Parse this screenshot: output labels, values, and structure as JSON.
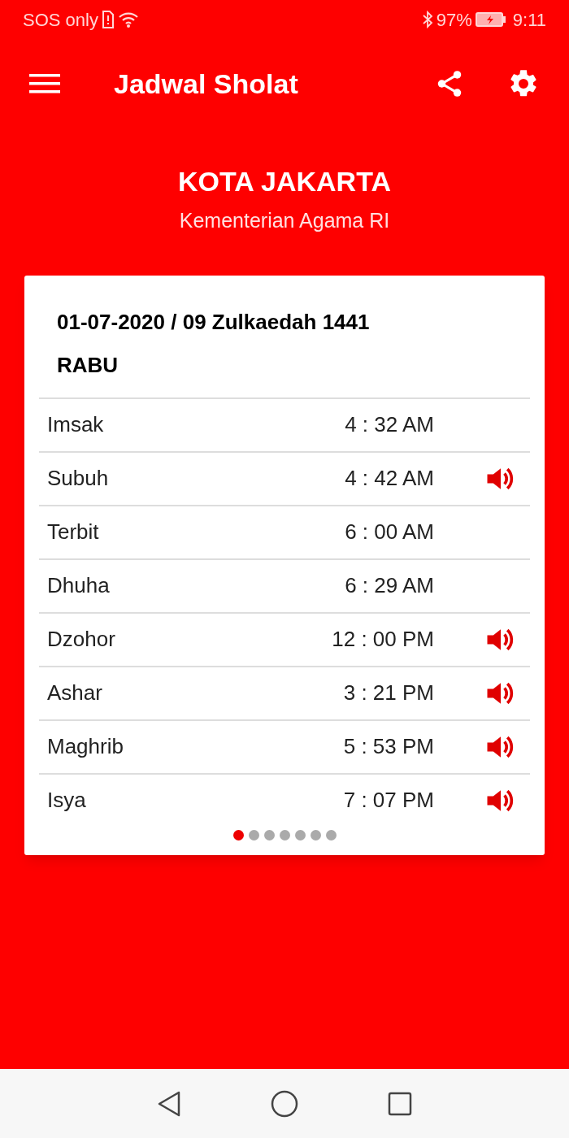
{
  "status_bar": {
    "carrier": "SOS only",
    "battery": "97%",
    "time": "9:11"
  },
  "app_bar": {
    "title": "Jadwal Sholat"
  },
  "location": {
    "city": "KOTA JAKARTA",
    "source": "Kementerian Agama RI"
  },
  "card": {
    "date": "01-07-2020 / 09 Zulkaedah 1441",
    "day": "RABU",
    "rows": [
      {
        "name": "Imsak",
        "time": "4 : 32 AM",
        "sound": false
      },
      {
        "name": "Subuh",
        "time": "4 : 42 AM",
        "sound": true
      },
      {
        "name": "Terbit",
        "time": "6 : 00 AM",
        "sound": false
      },
      {
        "name": "Dhuha",
        "time": "6 : 29 AM",
        "sound": false
      },
      {
        "name": "Dzohor",
        "time": "12 : 00 PM",
        "sound": true
      },
      {
        "name": "Ashar",
        "time": "3 : 21 PM",
        "sound": true
      },
      {
        "name": "Maghrib",
        "time": "5 : 53 PM",
        "sound": true
      },
      {
        "name": "Isya",
        "time": "7 : 07 PM",
        "sound": true
      }
    ],
    "pages": [
      {
        "selected": true
      },
      {
        "selected": false
      },
      {
        "selected": false
      },
      {
        "selected": false
      },
      {
        "selected": false
      },
      {
        "selected": false
      },
      {
        "selected": false
      }
    ]
  }
}
